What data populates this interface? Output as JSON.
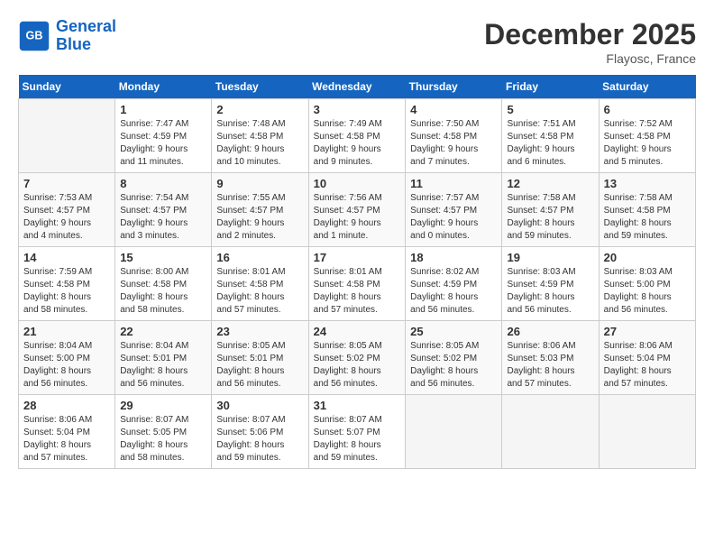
{
  "header": {
    "logo_line1": "General",
    "logo_line2": "Blue",
    "month": "December 2025",
    "location": "Flayosc, France"
  },
  "weekdays": [
    "Sunday",
    "Monday",
    "Tuesday",
    "Wednesday",
    "Thursday",
    "Friday",
    "Saturday"
  ],
  "weeks": [
    [
      {
        "day": "",
        "info": ""
      },
      {
        "day": "1",
        "info": "Sunrise: 7:47 AM\nSunset: 4:59 PM\nDaylight: 9 hours\nand 11 minutes."
      },
      {
        "day": "2",
        "info": "Sunrise: 7:48 AM\nSunset: 4:58 PM\nDaylight: 9 hours\nand 10 minutes."
      },
      {
        "day": "3",
        "info": "Sunrise: 7:49 AM\nSunset: 4:58 PM\nDaylight: 9 hours\nand 9 minutes."
      },
      {
        "day": "4",
        "info": "Sunrise: 7:50 AM\nSunset: 4:58 PM\nDaylight: 9 hours\nand 7 minutes."
      },
      {
        "day": "5",
        "info": "Sunrise: 7:51 AM\nSunset: 4:58 PM\nDaylight: 9 hours\nand 6 minutes."
      },
      {
        "day": "6",
        "info": "Sunrise: 7:52 AM\nSunset: 4:58 PM\nDaylight: 9 hours\nand 5 minutes."
      }
    ],
    [
      {
        "day": "7",
        "info": "Sunrise: 7:53 AM\nSunset: 4:57 PM\nDaylight: 9 hours\nand 4 minutes."
      },
      {
        "day": "8",
        "info": "Sunrise: 7:54 AM\nSunset: 4:57 PM\nDaylight: 9 hours\nand 3 minutes."
      },
      {
        "day": "9",
        "info": "Sunrise: 7:55 AM\nSunset: 4:57 PM\nDaylight: 9 hours\nand 2 minutes."
      },
      {
        "day": "10",
        "info": "Sunrise: 7:56 AM\nSunset: 4:57 PM\nDaylight: 9 hours\nand 1 minute."
      },
      {
        "day": "11",
        "info": "Sunrise: 7:57 AM\nSunset: 4:57 PM\nDaylight: 9 hours\nand 0 minutes."
      },
      {
        "day": "12",
        "info": "Sunrise: 7:58 AM\nSunset: 4:57 PM\nDaylight: 8 hours\nand 59 minutes."
      },
      {
        "day": "13",
        "info": "Sunrise: 7:58 AM\nSunset: 4:58 PM\nDaylight: 8 hours\nand 59 minutes."
      }
    ],
    [
      {
        "day": "14",
        "info": "Sunrise: 7:59 AM\nSunset: 4:58 PM\nDaylight: 8 hours\nand 58 minutes."
      },
      {
        "day": "15",
        "info": "Sunrise: 8:00 AM\nSunset: 4:58 PM\nDaylight: 8 hours\nand 58 minutes."
      },
      {
        "day": "16",
        "info": "Sunrise: 8:01 AM\nSunset: 4:58 PM\nDaylight: 8 hours\nand 57 minutes."
      },
      {
        "day": "17",
        "info": "Sunrise: 8:01 AM\nSunset: 4:58 PM\nDaylight: 8 hours\nand 57 minutes."
      },
      {
        "day": "18",
        "info": "Sunrise: 8:02 AM\nSunset: 4:59 PM\nDaylight: 8 hours\nand 56 minutes."
      },
      {
        "day": "19",
        "info": "Sunrise: 8:03 AM\nSunset: 4:59 PM\nDaylight: 8 hours\nand 56 minutes."
      },
      {
        "day": "20",
        "info": "Sunrise: 8:03 AM\nSunset: 5:00 PM\nDaylight: 8 hours\nand 56 minutes."
      }
    ],
    [
      {
        "day": "21",
        "info": "Sunrise: 8:04 AM\nSunset: 5:00 PM\nDaylight: 8 hours\nand 56 minutes."
      },
      {
        "day": "22",
        "info": "Sunrise: 8:04 AM\nSunset: 5:01 PM\nDaylight: 8 hours\nand 56 minutes."
      },
      {
        "day": "23",
        "info": "Sunrise: 8:05 AM\nSunset: 5:01 PM\nDaylight: 8 hours\nand 56 minutes."
      },
      {
        "day": "24",
        "info": "Sunrise: 8:05 AM\nSunset: 5:02 PM\nDaylight: 8 hours\nand 56 minutes."
      },
      {
        "day": "25",
        "info": "Sunrise: 8:05 AM\nSunset: 5:02 PM\nDaylight: 8 hours\nand 56 minutes."
      },
      {
        "day": "26",
        "info": "Sunrise: 8:06 AM\nSunset: 5:03 PM\nDaylight: 8 hours\nand 57 minutes."
      },
      {
        "day": "27",
        "info": "Sunrise: 8:06 AM\nSunset: 5:04 PM\nDaylight: 8 hours\nand 57 minutes."
      }
    ],
    [
      {
        "day": "28",
        "info": "Sunrise: 8:06 AM\nSunset: 5:04 PM\nDaylight: 8 hours\nand 57 minutes."
      },
      {
        "day": "29",
        "info": "Sunrise: 8:07 AM\nSunset: 5:05 PM\nDaylight: 8 hours\nand 58 minutes."
      },
      {
        "day": "30",
        "info": "Sunrise: 8:07 AM\nSunset: 5:06 PM\nDaylight: 8 hours\nand 59 minutes."
      },
      {
        "day": "31",
        "info": "Sunrise: 8:07 AM\nSunset: 5:07 PM\nDaylight: 8 hours\nand 59 minutes."
      },
      {
        "day": "",
        "info": ""
      },
      {
        "day": "",
        "info": ""
      },
      {
        "day": "",
        "info": ""
      }
    ]
  ]
}
